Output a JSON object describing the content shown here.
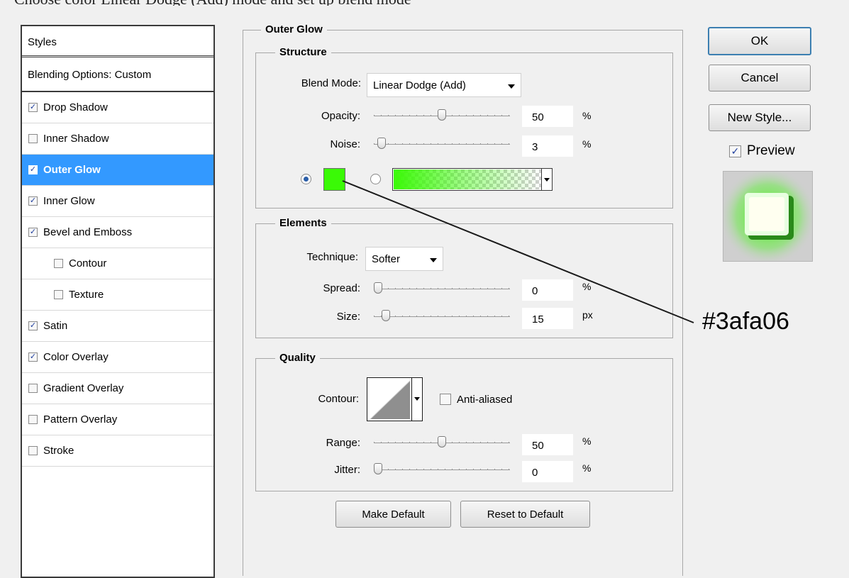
{
  "page_top_text": "Choose color Linear Dodge (Add) mode and set up blend mode",
  "left_panel": {
    "header": "Styles",
    "blending_options": "Blending Options: Custom",
    "items": [
      {
        "label": "Drop Shadow",
        "checked": true,
        "indent": false,
        "selected": false
      },
      {
        "label": "Inner Shadow",
        "checked": false,
        "indent": false,
        "selected": false
      },
      {
        "label": "Outer Glow",
        "checked": true,
        "indent": false,
        "selected": true
      },
      {
        "label": "Inner Glow",
        "checked": true,
        "indent": false,
        "selected": false
      },
      {
        "label": "Bevel and Emboss",
        "checked": true,
        "indent": false,
        "selected": false
      },
      {
        "label": "Contour",
        "checked": false,
        "indent": true,
        "selected": false
      },
      {
        "label": "Texture",
        "checked": false,
        "indent": true,
        "selected": false
      },
      {
        "label": "Satin",
        "checked": true,
        "indent": false,
        "selected": false
      },
      {
        "label": "Color Overlay",
        "checked": true,
        "indent": false,
        "selected": false
      },
      {
        "label": "Gradient Overlay",
        "checked": false,
        "indent": false,
        "selected": false
      },
      {
        "label": "Pattern Overlay",
        "checked": false,
        "indent": false,
        "selected": false
      },
      {
        "label": "Stroke",
        "checked": false,
        "indent": false,
        "selected": false
      }
    ]
  },
  "outer_glow": {
    "title": "Outer Glow",
    "structure": {
      "title": "Structure",
      "blend_mode_label": "Blend Mode:",
      "blend_mode_value": "Linear Dodge (Add)",
      "opacity_label": "Opacity:",
      "opacity_value": "50",
      "opacity_unit": "%",
      "opacity_level": 0.5,
      "noise_label": "Noise:",
      "noise_value": "3",
      "noise_unit": "%",
      "noise_level": 0.03,
      "color_hex": "#3afa06"
    },
    "elements": {
      "title": "Elements",
      "technique_label": "Technique:",
      "technique_value": "Softer",
      "spread_label": "Spread:",
      "spread_value": "0",
      "spread_unit": "%",
      "spread_level": 0,
      "size_label": "Size:",
      "size_value": "15",
      "size_unit": "px",
      "size_level": 0.06
    },
    "quality": {
      "title": "Quality",
      "contour_label": "Contour:",
      "anti_aliased_label": "Anti-aliased",
      "anti_aliased_checked": false,
      "range_label": "Range:",
      "range_value": "50",
      "range_unit": "%",
      "range_level": 0.5,
      "jitter_label": "Jitter:",
      "jitter_value": "0",
      "jitter_unit": "%",
      "jitter_level": 0
    },
    "make_default": "Make Default",
    "reset_default": "Reset to Default"
  },
  "right_panel": {
    "ok": "OK",
    "cancel": "Cancel",
    "new_style": "New Style...",
    "preview_label": "Preview",
    "preview_checked": true
  },
  "annotation_text": "#3afa06",
  "colors": {
    "selection": "#3399ff",
    "glow_green": "#3afa06"
  }
}
